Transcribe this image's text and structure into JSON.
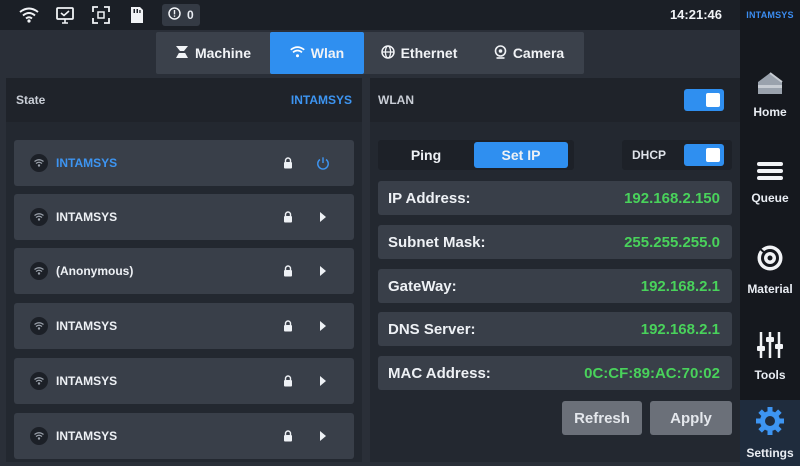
{
  "status_bar": {
    "icons": [
      "wifi-icon",
      "display-icon",
      "expand-icon",
      "sd-card-icon"
    ],
    "alert_count": "0",
    "time": "14:21:46"
  },
  "brand": "INTAMSYS",
  "tabs": [
    {
      "label": "Machine",
      "icon": "machine-icon",
      "active": false
    },
    {
      "label": "Wlan",
      "icon": "wifi-icon",
      "active": true
    },
    {
      "label": "Ethernet",
      "icon": "globe-icon",
      "active": false
    },
    {
      "label": "Camera",
      "icon": "camera-icon",
      "active": false
    }
  ],
  "state_panel": {
    "label": "State",
    "value": "INTAMSYS"
  },
  "networks": [
    {
      "name": "INTAMSYS",
      "selected": true,
      "action": "power"
    },
    {
      "name": "INTAMSYS",
      "selected": false,
      "action": "chevron"
    },
    {
      "name": "(Anonymous)",
      "selected": false,
      "action": "chevron"
    },
    {
      "name": "INTAMSYS",
      "selected": false,
      "action": "chevron"
    },
    {
      "name": "INTAMSYS",
      "selected": false,
      "action": "chevron"
    },
    {
      "name": "INTAMSYS",
      "selected": false,
      "action": "chevron"
    }
  ],
  "wlan": {
    "label": "WLAN",
    "enabled": true
  },
  "mode": {
    "ping_label": "Ping",
    "set_ip_label": "Set IP",
    "active": "Set IP"
  },
  "dhcp": {
    "label": "DHCP",
    "enabled": true
  },
  "ip_settings": [
    {
      "label": "IP Address:",
      "value": "192.168.2.150"
    },
    {
      "label": "Subnet Mask:",
      "value": "255.255.255.0"
    },
    {
      "label": "GateWay:",
      "value": "192.168.2.1"
    },
    {
      "label": "DNS Server:",
      "value": "192.168.2.1"
    },
    {
      "label": "MAC Address:",
      "value": "0C:CF:89:AC:70:02"
    }
  ],
  "buttons": {
    "refresh": "Refresh",
    "apply": "Apply"
  },
  "sidebar": {
    "items": [
      {
        "label": "Home",
        "icon": "home-icon",
        "active": false
      },
      {
        "label": "Queue",
        "icon": "queue-icon",
        "active": false
      },
      {
        "label": "Material",
        "icon": "material-spool-icon",
        "active": false
      },
      {
        "label": "Tools",
        "icon": "sliders-icon",
        "active": false
      },
      {
        "label": "Settings",
        "icon": "gear-icon",
        "active": true
      }
    ]
  },
  "colors": {
    "accent": "#2f8ff0",
    "value_green": "#49d25b",
    "background": "#2a2f38",
    "panel": "#232830",
    "row": "#393f49"
  }
}
